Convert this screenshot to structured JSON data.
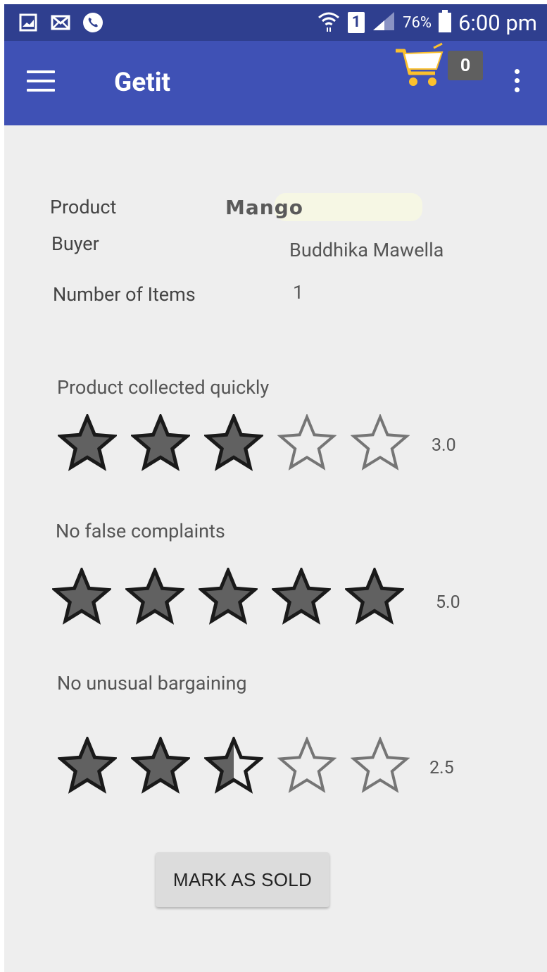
{
  "status_bar": {
    "icons_left": [
      "gallery-icon",
      "mail-icon",
      "phone-icon"
    ],
    "sim_label": "1",
    "battery_pct": "76%",
    "time": "6:00 pm"
  },
  "app_bar": {
    "title": "Getit",
    "cart_count": "0"
  },
  "details": {
    "product_label": "Product",
    "product_value": "Mango",
    "buyer_label": "Buyer",
    "buyer_value": "Buddhika Mawella",
    "items_label": "Number of Items",
    "items_value": "1"
  },
  "ratings": [
    {
      "title": "Product collected quickly",
      "value": "3.0",
      "stars": 3.0
    },
    {
      "title": "No false complaints",
      "value": "5.0",
      "stars": 5.0
    },
    {
      "title": "No unusual bargaining",
      "value": "2.5",
      "stars": 2.5
    }
  ],
  "actions": {
    "mark_sold_label": "MARK AS SOLD"
  },
  "colors": {
    "status_bar": "#2f3f8f",
    "app_bar": "#3f51b5",
    "background": "#eeeeee",
    "star_fill": "#616161",
    "star_outline": "#1a1a1a",
    "star_empty_outline": "#757575",
    "cart": "#fbc02d"
  }
}
